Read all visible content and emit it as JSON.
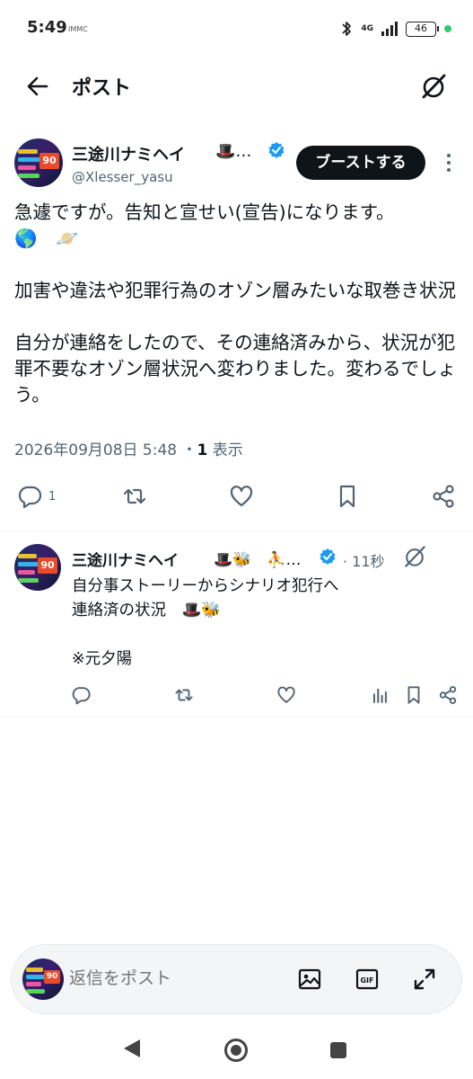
{
  "status_bar": {
    "time": "5:49",
    "tiny_text": "IMMC",
    "network": "4G",
    "battery": "46",
    "dot_color": "#2ecc71"
  },
  "header": {
    "title": "ポスト"
  },
  "main_post": {
    "author_name": "三途川ナミヘイ",
    "author_emoji": "🎩…",
    "handle": "@Xlesser_yasu",
    "boost_label": "ブーストする",
    "avatar_number": "90",
    "text_lines": [
      "急遽ですが。告知と宣せい(宣告)になります。",
      "🌎　🪐",
      "",
      "加害や違法や犯罪行為のオゾン層みたいな取巻き状況",
      "",
      "自分が連絡をしたので、その連絡済みから、状況が犯罪不要なオゾン層状況へ変わりました。変わるでしょう。"
    ],
    "timestamp": "2026年09月08日 5:48",
    "separator": "・",
    "views_count": "1",
    "views_label": "表示",
    "reply_count": "1"
  },
  "reply": {
    "author_name": "三途川ナミヘイ",
    "author_emoji": "🎩🐝　⛹…",
    "time": "· 11秒",
    "avatar_number": "90",
    "text_lines": [
      "自分事ストーリーからシナリオ犯行へ",
      "連絡済の状況　🎩🐝",
      "",
      "※元夕陽"
    ]
  },
  "composer": {
    "placeholder": "返信をポスト",
    "avatar_number": "90"
  },
  "colors": {
    "text_primary": "#0f1419",
    "text_secondary": "#536471",
    "verified": "#1d9bf0",
    "boost_button": "#0f1419"
  }
}
